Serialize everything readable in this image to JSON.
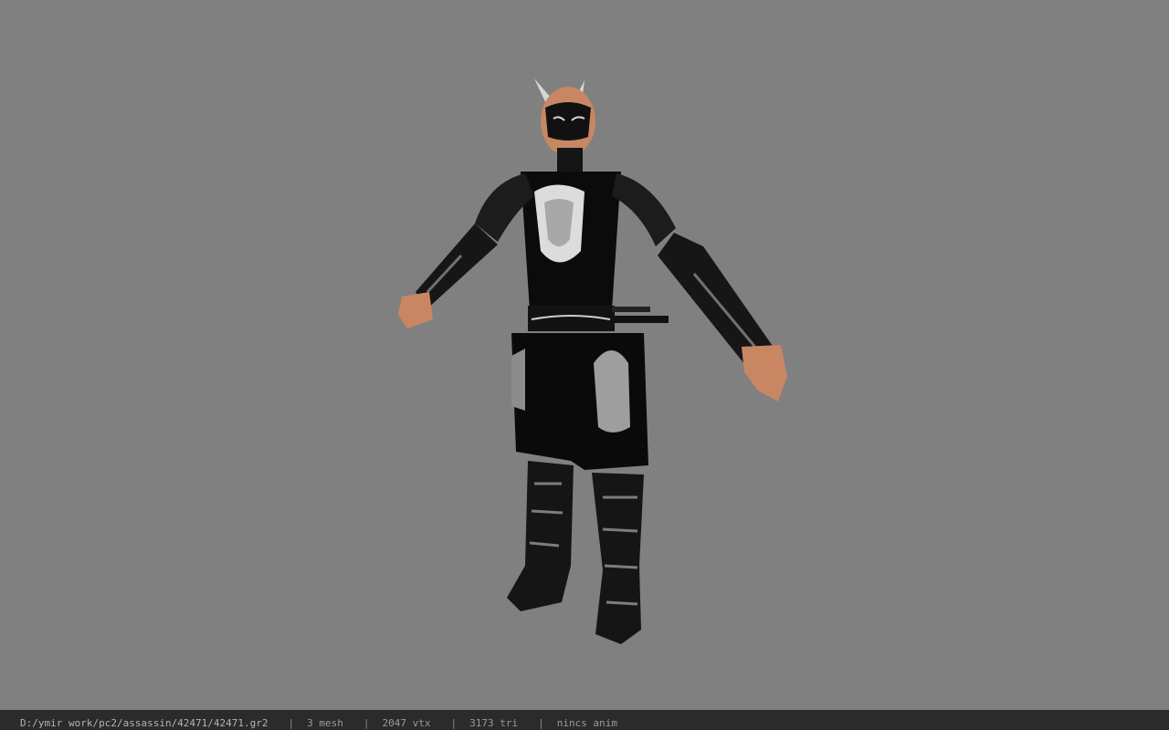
{
  "viewer": {
    "model_name": "assassin character model",
    "background_color": "#808080",
    "status_bar_color": "#2b2b2b"
  },
  "status": {
    "path": "D:/ymir work/pc2/assassin/42471/42471.gr2",
    "separator": "|",
    "mesh": "3 mesh",
    "vertices": "2047 vtx",
    "triangles": "3173 tri",
    "anim": "nincs anim"
  }
}
